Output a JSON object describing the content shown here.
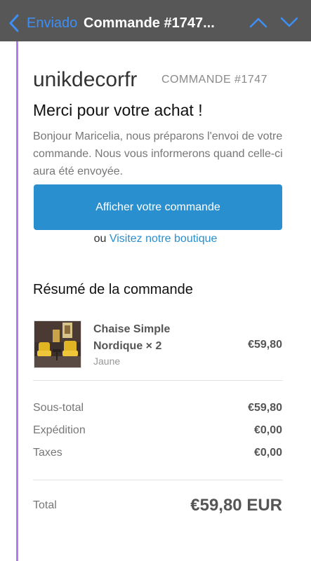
{
  "nav": {
    "back_label": "Enviado",
    "title": "Commande #1747..."
  },
  "email": {
    "shop_name": "unikdecorfr",
    "order_number": "COMMANDE #1747",
    "thanks": "Merci pour votre achat !",
    "intro": "Bonjour Maricelia, nous préparons l'envoi de votre commande. Nous vous informerons quand celle-ci aura été envoyée.",
    "view_order_label": "Afficher votre commande",
    "or_text": "ou",
    "shop_link_label": "Visitez notre boutique",
    "summary_heading": "Résumé de la commande",
    "item": {
      "name": "Chaise Simple Nordique × 2",
      "variant": "Jaune",
      "price": "€59,80"
    },
    "subtotal_label": "Sous-total",
    "subtotal_value": "€59,80",
    "shipping_label": "Expédition",
    "shipping_value": "€0,00",
    "taxes_label": "Taxes",
    "taxes_value": "€0,00",
    "total_label": "Total",
    "total_value": "€59,80 EUR"
  },
  "colors": {
    "navbar": "#575757",
    "nav_accent": "#3e8ff5",
    "button": "#2a8fcf",
    "quote_line": "#b57cf0"
  },
  "icons": {
    "back": "chevron-left-icon",
    "up": "chevron-up-icon",
    "down": "chevron-down-icon"
  }
}
